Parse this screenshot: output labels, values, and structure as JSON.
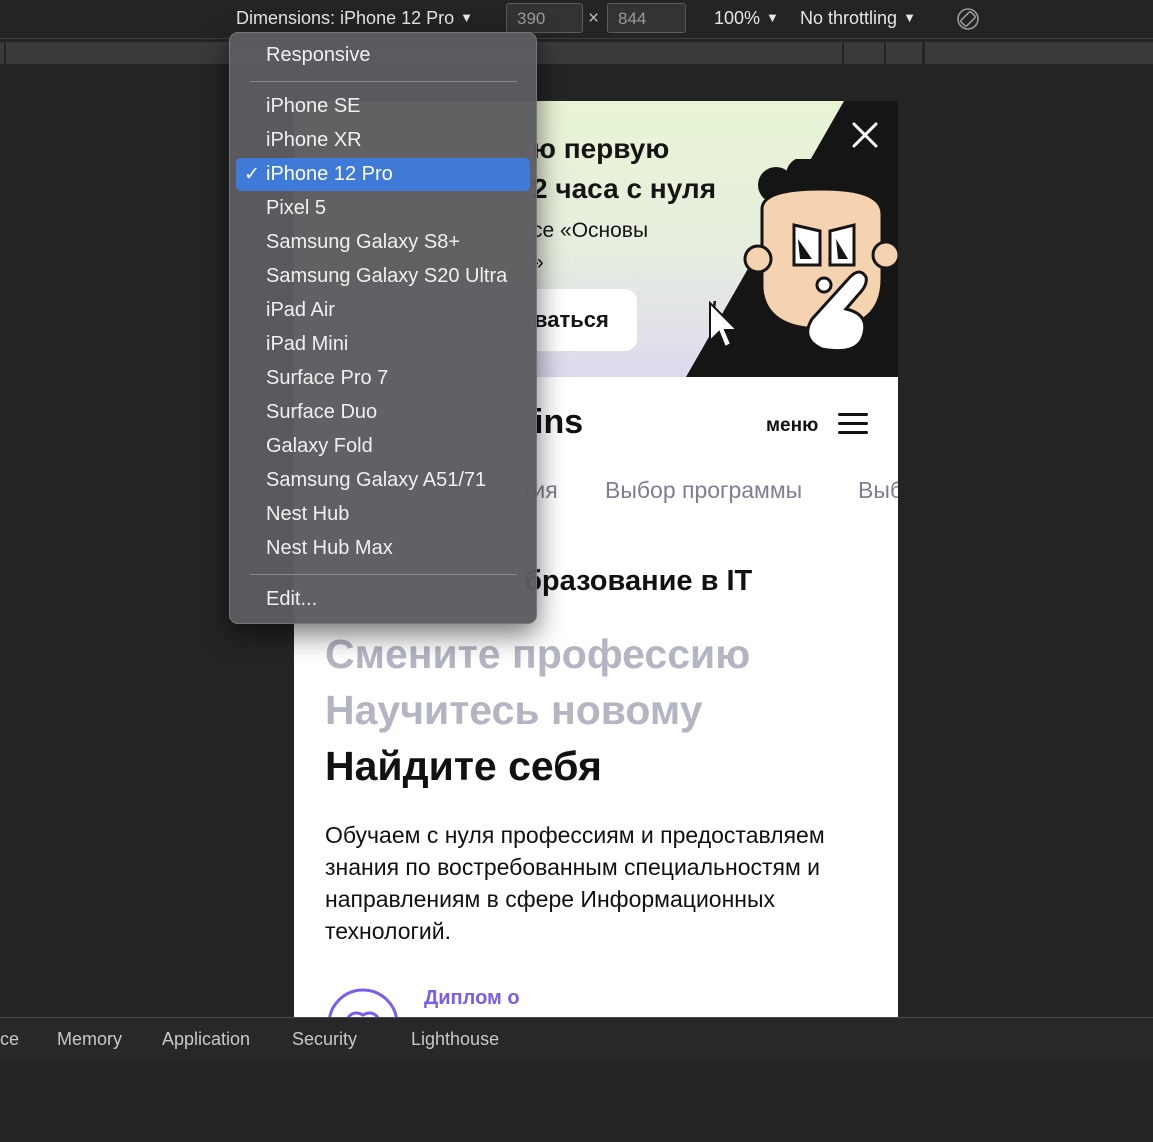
{
  "toolbar": {
    "dimensions_label": "Dimensions: iPhone 12 Pro",
    "width": "390",
    "height": "844",
    "times": "×",
    "zoom": "100%",
    "throttling": "No throttling",
    "caret": "▼"
  },
  "dropdown": {
    "items": [
      {
        "label": "Responsive"
      },
      {
        "label": "iPhone SE"
      },
      {
        "label": "iPhone XR"
      },
      {
        "label": "iPhone 12 Pro",
        "selected": true
      },
      {
        "label": "Pixel 5"
      },
      {
        "label": "Samsung Galaxy S8+"
      },
      {
        "label": "Samsung Galaxy S20 Ultra"
      },
      {
        "label": "iPad Air"
      },
      {
        "label": "iPad Mini"
      },
      {
        "label": "Surface Pro 7"
      },
      {
        "label": "Surface Duo"
      },
      {
        "label": "Galaxy Fold"
      },
      {
        "label": "Samsung Galaxy A51/71"
      },
      {
        "label": "Nest Hub"
      },
      {
        "label": "Nest Hub Max"
      },
      {
        "label": "Edit..."
      }
    ],
    "check": "✓",
    "selected_color": "#3f7ad9"
  },
  "page": {
    "banner": {
      "title_line1": "ю первую",
      "title_line2": "2 часа с нуля",
      "subtitle_line1": "се «Основы",
      "subtitle_line2": "»",
      "button_label": "ваться"
    },
    "header": {
      "logo": "ins",
      "menu_label": "меню"
    },
    "nav_tabs": [
      "гия",
      "Выбор программы",
      "Выб"
    ],
    "eyebrow": "бразование в IT",
    "hero": {
      "line1": "Смените профессию",
      "line2": "Научитесь новому",
      "line3": "Найдите себя"
    },
    "description": "Обучаем с нуля профессиям и предоставляем знания по востребованным специальностям и направлениям в сфере Информационных технологий.",
    "diploma_label": "Диплом о",
    "accent_color": "#7a5cf0"
  },
  "panel": {
    "tabs": [
      "ce",
      "Memory",
      "Application",
      "Security",
      "Lighthouse"
    ]
  }
}
